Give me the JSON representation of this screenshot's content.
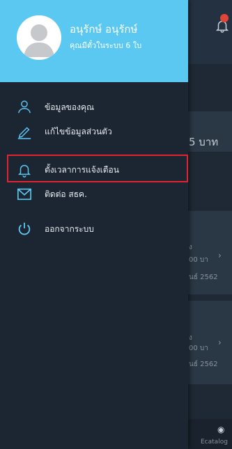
{
  "drawer": {
    "user_name": "อนุรักษ์ อนุรักษ์",
    "ticket_info": "คุณมีตั๋วในระบบ 6 ใบ",
    "menu": [
      {
        "label": "ข้อมูลของคุณ",
        "icon": "user-icon"
      },
      {
        "label": "แก้ไขข้อมูลส่วนตัว",
        "icon": "edit-pencil-icon"
      },
      {
        "label": "ตั้งเวลาการแจ้งเตือน",
        "icon": "bell-icon"
      },
      {
        "label": "ติดต่อ สธค.",
        "icon": "mail-icon"
      },
      {
        "label": "ออกจากระบบ",
        "icon": "power-icon"
      }
    ]
  },
  "background": {
    "amount_partial": "5 บาท",
    "card1": {
      "line1": "ง",
      "line2": "00 บา",
      "line3": "นธ์ 2562"
    },
    "card2": {
      "line1": "ง",
      "line2": "00 บา",
      "line3": "นธ์ 2562"
    },
    "footer_label": "Ecatalog"
  },
  "colors": {
    "drawer_header": "#5bc8f2",
    "drawer_bg": "#1c2632",
    "highlight_border": "#e02530"
  }
}
